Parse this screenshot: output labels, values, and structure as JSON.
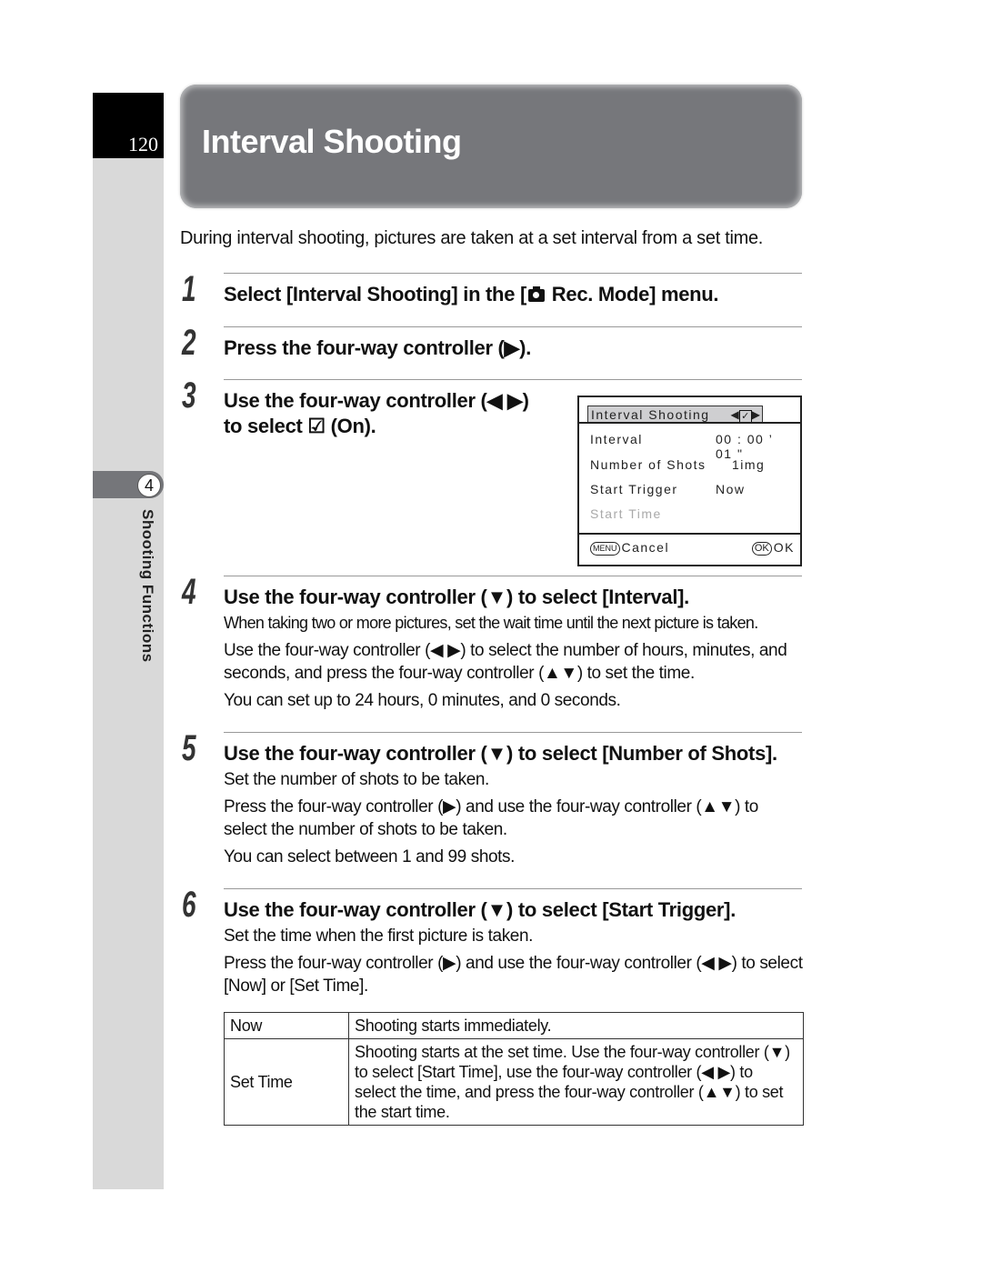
{
  "page": {
    "number": "120",
    "chapter_number": "4",
    "chapter_label": "Shooting Functions",
    "title": "Interval Shooting",
    "intro": "During interval shooting, pictures are taken at a set interval from a set time.",
    "colors": {
      "banner": "#76777b",
      "sidebar": "#d9d9d9",
      "page_box": "#000000"
    }
  },
  "steps": [
    {
      "num": "1",
      "heading_pre": "Select [Interval Shooting] in the [",
      "heading_icon": "camera-icon",
      "heading_post": " Rec. Mode] menu."
    },
    {
      "num": "2",
      "heading": "Press the four-way controller (▶)."
    },
    {
      "num": "3",
      "heading_line1": "Use the four-way controller (◀ ▶)",
      "heading_line2": "to select ☑ (On)."
    },
    {
      "num": "4",
      "heading": "Use the four-way controller (▼) to select [Interval].",
      "body": [
        "When taking two or more pictures, set the wait time until the next picture is taken.",
        "Use the four-way controller (◀ ▶) to select the number of hours, minutes, and seconds, and press the four-way controller (▲▼) to set the time.",
        "You can set up to 24 hours, 0 minutes, and 0 seconds."
      ]
    },
    {
      "num": "5",
      "heading": "Use the four-way controller (▼) to select [Number of Shots].",
      "body": [
        "Set the number of shots to be taken.",
        "Press the four-way controller (▶) and use the four-way controller (▲▼) to select the number of shots to be taken.",
        "You can select between 1 and 99 shots."
      ]
    },
    {
      "num": "6",
      "heading": "Use the four-way controller (▼) to select [Start Trigger].",
      "body": [
        "Set the time when the first picture is taken.",
        "Press the four-way controller (▶) and use the four-way controller (◀ ▶) to select [Now] or [Set Time]."
      ]
    }
  ],
  "lcd": {
    "header": "Interval Shooting",
    "toggle_left": "◀",
    "toggle_box": "✓",
    "toggle_right": "▶",
    "rows": [
      {
        "label": "Interval",
        "value": "00 : 00 ’ 01 \""
      },
      {
        "label": "Number of Shots",
        "value": " 1img"
      },
      {
        "label": "Start Trigger",
        "value": "Now"
      },
      {
        "label": "Start Time",
        "value": ""
      }
    ],
    "menu_btn": "MENU",
    "cancel": "Cancel",
    "ok_btn": "OK",
    "ok": "OK"
  },
  "trigger_table": {
    "rows": [
      {
        "option": "Now",
        "description": "Shooting starts immediately."
      },
      {
        "option": "Set Time",
        "description": "Shooting starts at the set time. Use the four-way controller (▼) to select [Start Time], use the four-way controller (◀ ▶) to select the time, and press the four-way controller (▲▼) to set the start time."
      }
    ]
  }
}
